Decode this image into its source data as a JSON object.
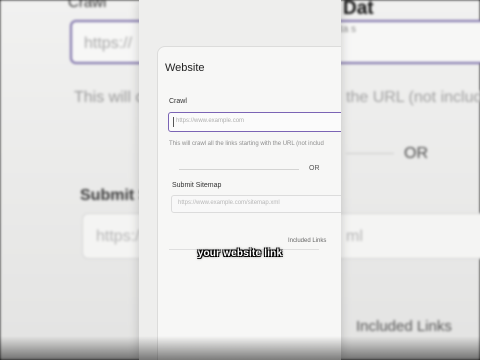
{
  "background": {
    "crawl_label": "Crawl",
    "input_placeholder": "https://",
    "helper_text": "This will c",
    "helper_text_right": "the URL (not includi",
    "title": "Dat",
    "subtitle": "Add your data s",
    "or_text": "OR",
    "submit_label": "Submit S",
    "sitemap_placeholder": "https:/",
    "sitemap_placeholder_right": "ml",
    "included_links": "Included Links"
  },
  "dialog": {
    "title": "Website",
    "crawl_label": "Crawl",
    "crawl_placeholder": "https://www.example.com",
    "crawl_helper": "This will crawl all the links starting with the URL (not includ",
    "or_text": "OR",
    "sitemap_label": "Submit Sitemap",
    "sitemap_placeholder": "https://www.example.com/sitemap.xml",
    "included_links": "Included Links"
  },
  "caption": "your website link",
  "colors": {
    "accent": "#7b64b5",
    "background": "#eeeeed",
    "caption_text": "#ffffff"
  }
}
